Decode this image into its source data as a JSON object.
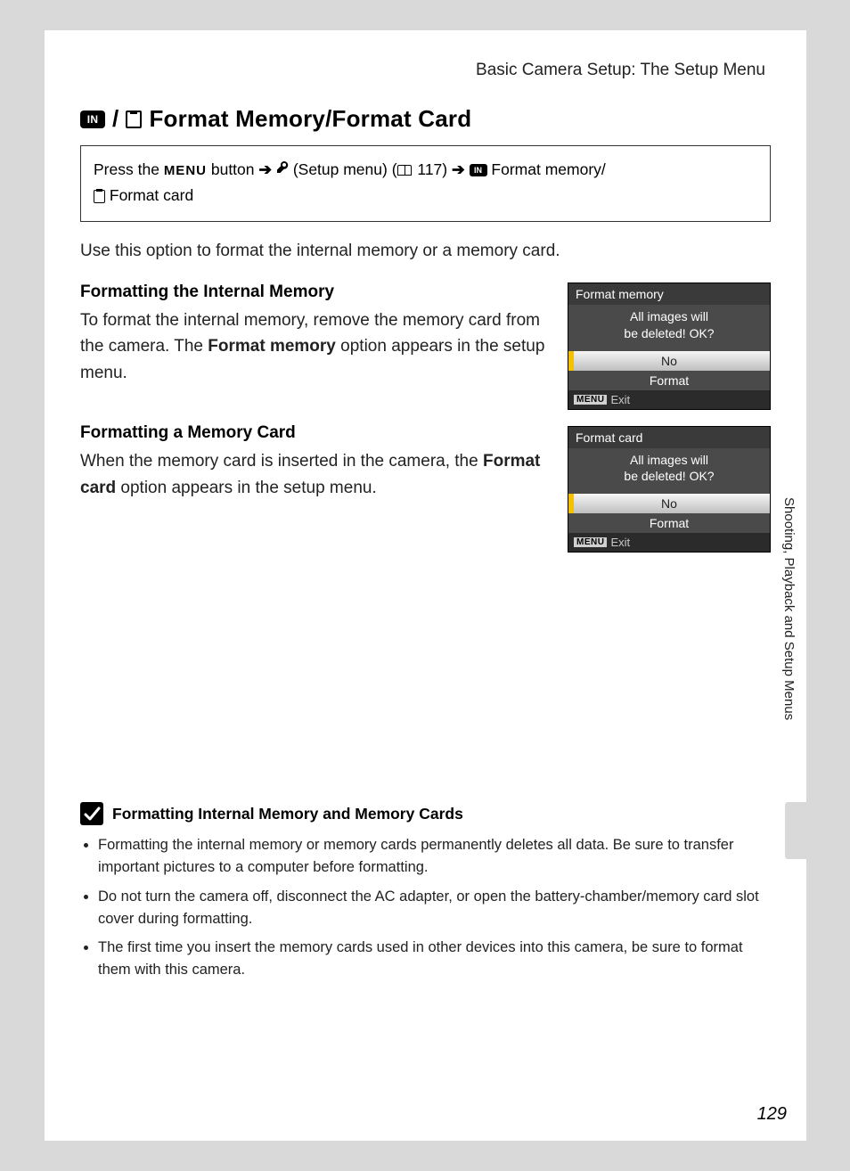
{
  "runhead": "Basic Camera Setup: The Setup Menu",
  "title": "Format Memory/Format Card",
  "nav": {
    "press": "Press the",
    "menu": "MENU",
    "button": "button",
    "setup": "(Setup menu) (",
    "pageref": " 117)",
    "fm": "Format memory/",
    "fc": "Format card"
  },
  "lead": "Use this option to format the internal memory or a memory card.",
  "sec1": {
    "heading": "Formatting the Internal Memory",
    "text1": "To format the internal memory, remove the memory card from the camera. The ",
    "bold": "Format memory",
    "text2": " option appears in the setup menu."
  },
  "sec2": {
    "heading": "Formatting a Memory Card",
    "text1": "When the memory card is inserted in the camera, the ",
    "bold": "Format card",
    "text2": " option appears in the setup menu."
  },
  "lcd1": {
    "title": "Format memory",
    "l1": "All images will",
    "l2": "be deleted! OK?",
    "no": "No",
    "format": "Format",
    "menu": "MENU",
    "exit": "Exit"
  },
  "lcd2": {
    "title": "Format card",
    "l1": "All images will",
    "l2": "be deleted! OK?",
    "no": "No",
    "format": "Format",
    "menu": "MENU",
    "exit": "Exit"
  },
  "sidetab": "Shooting, Playback and Setup Menus",
  "note": {
    "title": "Formatting Internal Memory and Memory Cards",
    "b1": "Formatting the internal memory or memory cards permanently deletes all data. Be sure to transfer important pictures to a computer before formatting.",
    "b2": "Do not turn the camera off, disconnect the AC adapter, or open the battery-chamber/memory card slot cover during formatting.",
    "b3": "The first time you insert the memory cards used in other devices into this camera, be sure to format them with this camera."
  },
  "pagenum": "129"
}
